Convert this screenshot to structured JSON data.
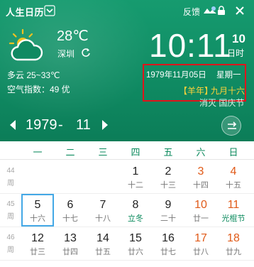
{
  "titlebar": {
    "app_title": "人生日历",
    "feedback_label": "反馈"
  },
  "weather": {
    "temperature": "28℃",
    "city": "深圳",
    "condition": "多云 25~33℃",
    "aqi": "空气指数：49 优",
    "icon": "partly-cloudy-icon"
  },
  "clock": {
    "time": "10:11",
    "day": "10",
    "period": "日时"
  },
  "date_info": {
    "full_date": "1979年11月05日",
    "weekday": "星期一",
    "lunar_year": "【羊年】",
    "lunar_date": "九月十六",
    "festival": "消灭 国庆节"
  },
  "nav": {
    "year": "1979",
    "separator": "-",
    "month": "11"
  },
  "weekdays": [
    "一",
    "二",
    "三",
    "四",
    "五",
    "六",
    "日"
  ],
  "weeks": [
    {
      "week_label": [
        "44",
        "周"
      ],
      "days": [
        null,
        null,
        null,
        {
          "d": "1",
          "l": "十二"
        },
        {
          "d": "2",
          "l": "十三"
        },
        {
          "d": "3",
          "l": "十四",
          "weekend": true
        },
        {
          "d": "4",
          "l": "十五",
          "weekend": true
        }
      ]
    },
    {
      "week_label": [
        "45",
        "周"
      ],
      "days": [
        {
          "d": "5",
          "l": "十六",
          "today": true
        },
        {
          "d": "6",
          "l": "十七"
        },
        {
          "d": "7",
          "l": "十八"
        },
        {
          "d": "8",
          "l": "立冬",
          "term": true
        },
        {
          "d": "9",
          "l": "二十"
        },
        {
          "d": "10",
          "l": "廿一",
          "weekend": true
        },
        {
          "d": "11",
          "l": "光棍节",
          "weekend": true,
          "term": true
        }
      ]
    },
    {
      "week_label": [
        "46",
        "周"
      ],
      "days": [
        {
          "d": "12",
          "l": "廿三"
        },
        {
          "d": "13",
          "l": "廿四"
        },
        {
          "d": "14",
          "l": "廿五"
        },
        {
          "d": "15",
          "l": "廿六"
        },
        {
          "d": "16",
          "l": "廿七"
        },
        {
          "d": "17",
          "l": "廿八",
          "weekend": true
        },
        {
          "d": "18",
          "l": "廿九",
          "weekend": true
        }
      ]
    }
  ],
  "colors": {
    "header_green": "#0f8a62",
    "highlight_red": "#e0141b",
    "lunar_gold": "#ffd23a",
    "weekend_orange": "#e05a18",
    "today_blue": "#43a8e6"
  }
}
